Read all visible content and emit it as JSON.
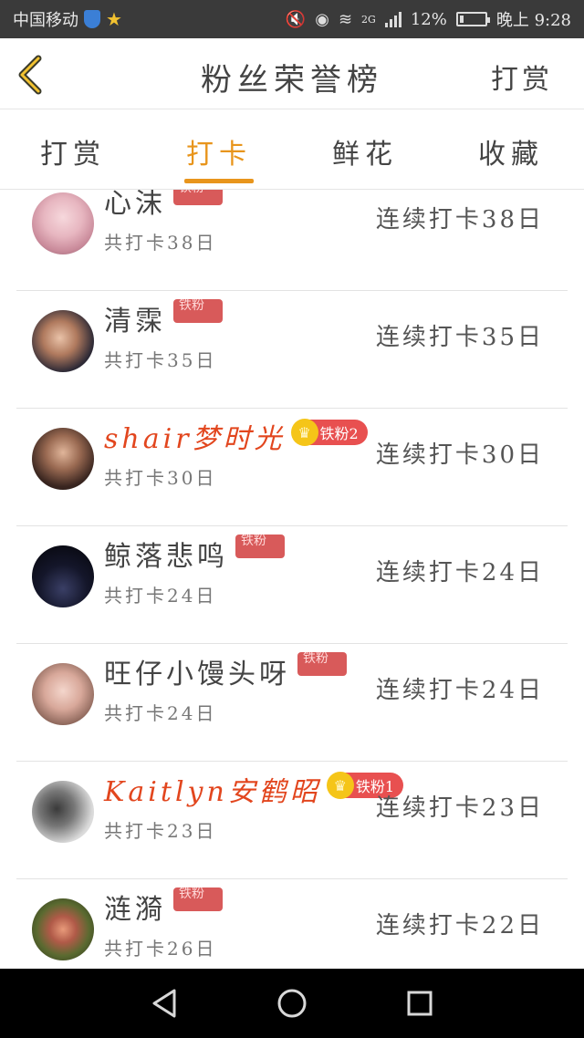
{
  "status_bar": {
    "carrier": "中国移动",
    "network": "2G",
    "battery": "12%",
    "time": "晚上 9:28"
  },
  "header": {
    "title": "粉丝荣誉榜",
    "right_action": "打赏"
  },
  "tabs": [
    {
      "label": "打赏",
      "active": false
    },
    {
      "label": "打卡",
      "active": true
    },
    {
      "label": "鲜花",
      "active": false
    },
    {
      "label": "收藏",
      "active": false
    }
  ],
  "colors": {
    "accent": "#e8951c",
    "vip_name": "#e2461e",
    "badge": "#d85a5a",
    "status_bar": "#3a3a3a"
  },
  "list": [
    {
      "name": "心沫",
      "vip": false,
      "badge": "铁粉",
      "total": "共打卡38日",
      "streak": "连续打卡38日"
    },
    {
      "name": "清霂",
      "vip": false,
      "badge": "铁粉",
      "total": "共打卡35日",
      "streak": "连续打卡35日"
    },
    {
      "name": "shair梦时光",
      "vip": true,
      "badge": "铁粉2",
      "total": "共打卡30日",
      "streak": "连续打卡30日"
    },
    {
      "name": "鲸落悲鸣",
      "vip": false,
      "badge": "铁粉",
      "total": "共打卡24日",
      "streak": "连续打卡24日"
    },
    {
      "name": "旺仔小馒头呀",
      "vip": false,
      "badge": "铁粉",
      "total": "共打卡24日",
      "streak": "连续打卡24日"
    },
    {
      "name": "Kaitlyn安鹤昭",
      "vip": true,
      "badge": "铁粉1",
      "total": "共打卡23日",
      "streak": "连续打卡23日"
    },
    {
      "name": "涟漪",
      "vip": false,
      "badge": "铁粉",
      "total": "共打卡26日",
      "streak": "连续打卡22日"
    }
  ]
}
